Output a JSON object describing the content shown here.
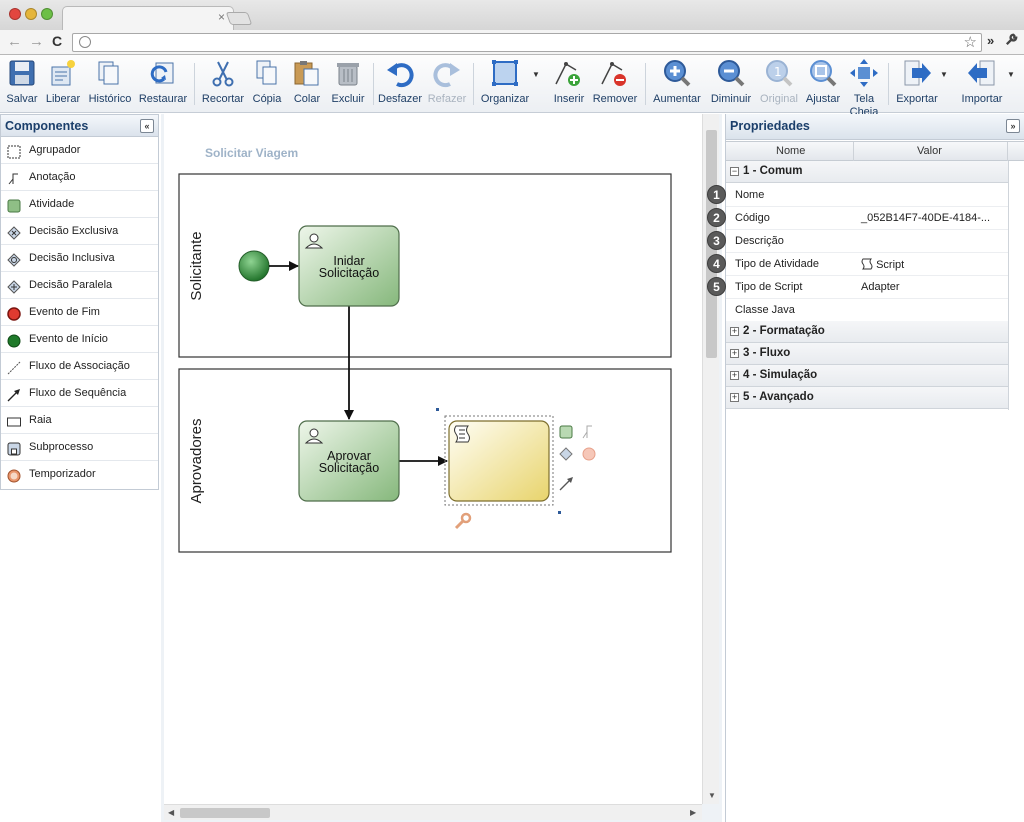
{
  "browser": {
    "tab_close": "×",
    "back_glyph": "←",
    "forward_glyph": "→",
    "reload_glyph": "C",
    "star_glyph": "☆",
    "menu_chevron": "»"
  },
  "toolbar": {
    "buttons": [
      {
        "id": "salvar",
        "label": "Salvar",
        "icon": "floppy-disk-icon",
        "enabled": true
      },
      {
        "id": "liberar",
        "label": "Liberar",
        "icon": "publish-icon",
        "enabled": true
      },
      {
        "id": "historico",
        "label": "Histórico",
        "icon": "history-icon",
        "enabled": true
      },
      {
        "id": "restaurar",
        "label": "Restaurar",
        "icon": "restore-icon",
        "enabled": true
      },
      {
        "id": "recortar",
        "label": "Recortar",
        "icon": "scissors-icon",
        "enabled": true
      },
      {
        "id": "copia",
        "label": "Cópia",
        "icon": "copy-icon",
        "enabled": true
      },
      {
        "id": "colar",
        "label": "Colar",
        "icon": "paste-icon",
        "enabled": true
      },
      {
        "id": "excluir",
        "label": "Excluir",
        "icon": "trash-icon",
        "enabled": true
      },
      {
        "id": "desfazer",
        "label": "Desfazer",
        "icon": "undo-icon",
        "enabled": true
      },
      {
        "id": "refazer",
        "label": "Refazer",
        "icon": "redo-icon",
        "enabled": false
      },
      {
        "id": "organizar",
        "label": "Organizar",
        "icon": "arrange-icon",
        "enabled": true
      },
      {
        "id": "inserir",
        "label": "Inserir",
        "icon": "insert-point-icon",
        "enabled": true
      },
      {
        "id": "remover",
        "label": "Remover",
        "icon": "remove-point-icon",
        "enabled": true
      },
      {
        "id": "aumentar",
        "label": "Aumentar",
        "icon": "zoom-in-icon",
        "enabled": true
      },
      {
        "id": "diminuir",
        "label": "Diminuir",
        "icon": "zoom-out-icon",
        "enabled": true
      },
      {
        "id": "original",
        "label": "Original",
        "icon": "zoom-original-icon",
        "enabled": false
      },
      {
        "id": "ajustar",
        "label": "Ajustar",
        "icon": "zoom-fit-icon",
        "enabled": true
      },
      {
        "id": "tela-cheia",
        "label": "Tela Cheia",
        "icon": "fullscreen-icon",
        "enabled": true
      },
      {
        "id": "exportar",
        "label": "Exportar",
        "icon": "export-icon",
        "enabled": true
      },
      {
        "id": "importar",
        "label": "Importar",
        "icon": "import-icon",
        "enabled": true
      }
    ]
  },
  "components_panel": {
    "title": "Componentes",
    "collapse_glyph": "«",
    "items": [
      {
        "label": "Agrupador",
        "icon": "group-icon"
      },
      {
        "label": "Anotação",
        "icon": "annotation-icon"
      },
      {
        "label": "Atividade",
        "icon": "activity-icon"
      },
      {
        "label": "Decisão Exclusiva",
        "icon": "exclusive-gateway-icon"
      },
      {
        "label": "Decisão Inclusiva",
        "icon": "inclusive-gateway-icon"
      },
      {
        "label": "Decisão Paralela",
        "icon": "parallel-gateway-icon"
      },
      {
        "label": "Evento de Fim",
        "icon": "end-event-icon"
      },
      {
        "label": "Evento de Início",
        "icon": "start-event-icon"
      },
      {
        "label": "Fluxo de Associação",
        "icon": "association-flow-icon"
      },
      {
        "label": "Fluxo de Sequência",
        "icon": "sequence-flow-icon"
      },
      {
        "label": "Raia",
        "icon": "lane-icon"
      },
      {
        "label": "Subprocesso",
        "icon": "subprocess-icon"
      },
      {
        "label": "Temporizador",
        "icon": "timer-icon"
      }
    ]
  },
  "diagram": {
    "process_title": "Solicitar Viagem",
    "lanes": [
      {
        "label": "Solicitante"
      },
      {
        "label": "Aprovadores"
      }
    ],
    "tasks": [
      {
        "line1": "Inidar",
        "line2": "Solicitação"
      },
      {
        "line1": "Aprovar",
        "line2": "Solicitação"
      }
    ]
  },
  "properties_panel": {
    "title": "Propriedades",
    "expand_glyph": "»",
    "col_name": "Nome",
    "col_value": "Valor",
    "groups": [
      {
        "label": "1 - Comum",
        "expanded": true
      },
      {
        "label": "2 - Formatação",
        "expanded": false
      },
      {
        "label": "3 - Fluxo",
        "expanded": false
      },
      {
        "label": "4 - Simulação",
        "expanded": false
      },
      {
        "label": "5 - Avançado",
        "expanded": false
      }
    ],
    "minus_glyph": "−",
    "plus_glyph": "+",
    "rows": [
      {
        "badge": "1",
        "name": "Nome",
        "value": ""
      },
      {
        "badge": "2",
        "name": "Código",
        "value": "_052B14F7-40DE-4184-..."
      },
      {
        "badge": "3",
        "name": "Descrição",
        "value": ""
      },
      {
        "badge": "4",
        "name": "Tipo de Atividade",
        "value": "Script"
      },
      {
        "badge": "5",
        "name": "Tipo de Script",
        "value": "Adapter"
      },
      {
        "badge": "",
        "name": "Classe Java",
        "value": ""
      }
    ]
  },
  "colors": {
    "task_fill_top": "#e6f0e2",
    "task_fill_bottom": "#8fbf86",
    "script_task_top": "#fffdf0",
    "script_task_bottom": "#ecd97a",
    "accent_title": "#1b3f6b"
  }
}
